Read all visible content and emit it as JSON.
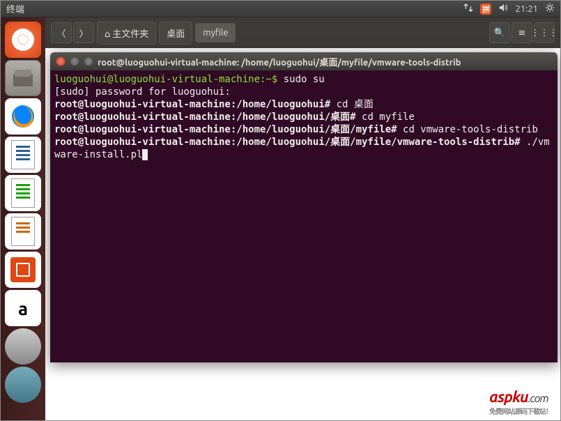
{
  "menubar": {
    "title": "终端",
    "clock": "21:21",
    "ime": "拼"
  },
  "launcher": {
    "amazon": "a"
  },
  "nautilus": {
    "back": "〈",
    "forward": "〉",
    "home": "主文件夹",
    "crumb1": "桌面",
    "crumb2": "myfile",
    "search": "🔍",
    "view": "≡",
    "grid": "⋮⋮⋮"
  },
  "terminal": {
    "title": "root@luoguohui-virtual-machine: /home/luoguohui/桌面/myfile/vmware-tools-distrib",
    "lines": {
      "l1_user": "luoguohui@luoguohui-virtual-machine:~$ ",
      "l1_cmd": "sudo su",
      "l2": "[sudo] password for luoguohui: ",
      "l3_prompt": "root@luoguohui-virtual-machine:/home/luoguohui# ",
      "l3_cmd": "cd 桌面",
      "l4_prompt": "root@luoguohui-virtual-machine:/home/luoguohui/桌面# ",
      "l4_cmd": "cd myfile",
      "l5_prompt": "root@luoguohui-virtual-machine:/home/luoguohui/桌面/myfile# ",
      "l5_cmd": "cd vmware-tools-distrib",
      "l6_prompt": "root@luoguohui-virtual-machine:/home/luoguohui/桌面/myfile/vmware-tools-distrib# ",
      "l6_cmd": "./vmware-install.pl"
    }
  },
  "watermark": {
    "brand": "aspku",
    "domain": ".com",
    "tagline": "免费网站源码下载站！"
  }
}
